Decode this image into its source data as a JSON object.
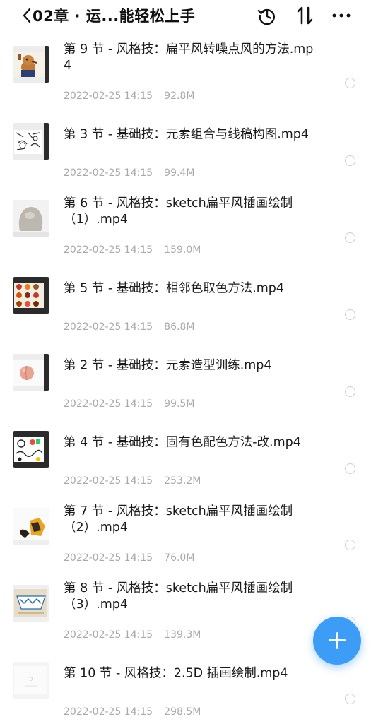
{
  "header": {
    "title": "02章 · 运...能轻松上手",
    "back_icon": "chevron-left-icon",
    "history_icon": "history-icon",
    "sort_icon": "sort-icon",
    "more_icon": "more-horizontal-icon"
  },
  "files": [
    {
      "name": "第 9 节 - 风格技：扁平风转噪点风的方法.mp4",
      "date": "2022-02-25 14:15",
      "size": "92.8M",
      "thumb": "dog-illustration"
    },
    {
      "name": "第 3 节 - 基础技：元素组合与线稿构图.mp4",
      "date": "2022-02-25 14:15",
      "size": "99.4M",
      "thumb": "line-art"
    },
    {
      "name": "第 6 节 - 风格技：sketch扁平风插画绘制（1）.mp4",
      "date": "2022-02-25 14:15",
      "size": "159.0M",
      "thumb": "grey-blob"
    },
    {
      "name": "第 5 节 - 基础技：相邻色取色方法.mp4",
      "date": "2022-02-25 14:15",
      "size": "86.8M",
      "thumb": "food-pattern"
    },
    {
      "name": "第 2 节 - 基础技：元素造型训练.mp4",
      "date": "2022-02-25 14:15",
      "size": "99.5M",
      "thumb": "peach"
    },
    {
      "name": "第 4 节 - 基础技：固有色配色方法-改.mp4",
      "date": "2022-02-25 14:15",
      "size": "253.2M",
      "thumb": "doodle-pattern"
    },
    {
      "name": "第 7 节 - 风格技：sketch扁平风插画绘制（2）.mp4",
      "date": "2022-02-25 14:15",
      "size": "76.0M",
      "thumb": "character"
    },
    {
      "name": "第 8 节 - 风格技：sketch扁平风插画绘制（3）.mp4",
      "date": "2022-02-25 14:15",
      "size": "139.3M",
      "thumb": "pattern-bowl"
    },
    {
      "name": "第 10 节 - 风格技：2.5D 插画绘制.mp4",
      "date": "2022-02-25 14:15",
      "size": "298.5M",
      "thumb": "blank-sketch"
    }
  ],
  "fab_icon": "plus-icon",
  "colors": {
    "accent": "#3d9cf5",
    "meta_text": "#a9a9a9",
    "radio_border": "#cfcfcf"
  }
}
